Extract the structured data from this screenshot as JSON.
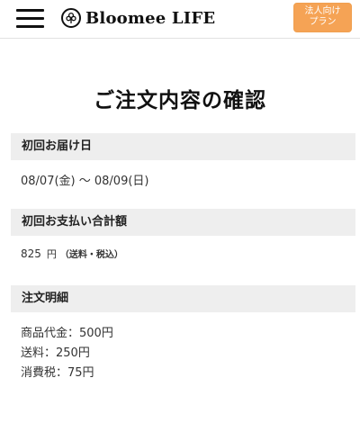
{
  "header": {
    "brand": "Bloomee LIFE",
    "corporate_button_line1": "法人向け",
    "corporate_button_line2": "プラン"
  },
  "page": {
    "title": "ご注文内容の確認"
  },
  "sections": {
    "first_delivery": {
      "heading": "初回お届け日",
      "value": "08/07(金) 〜 08/09(日)"
    },
    "first_payment": {
      "heading": "初回お支払い合計額",
      "amount": "825",
      "unit": "円",
      "tax_note": "（送料・税込）"
    },
    "order_details": {
      "heading": "注文明細",
      "lines": [
        "商品代金：500円",
        "送料：250円",
        "消費税：75円"
      ]
    }
  },
  "icons": {
    "menu": "hamburger-menu-icon",
    "logo": "bloomee-logo-icon"
  },
  "colors": {
    "accent": "#f5a355",
    "section_bg": "#eeeeee"
  }
}
